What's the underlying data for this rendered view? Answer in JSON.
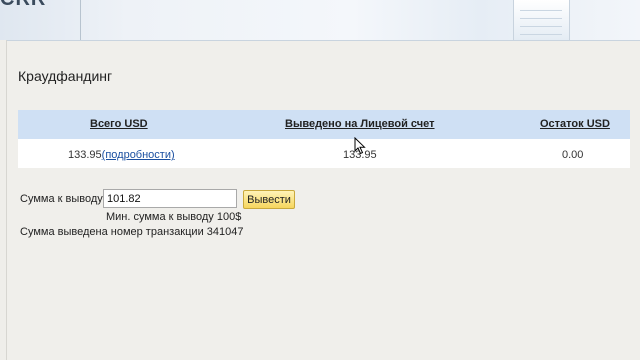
{
  "header": {
    "logo_text": "CRR"
  },
  "page": {
    "title": "Краудфандинг"
  },
  "table": {
    "columns": [
      "Всего USD",
      "Выведено на Лицевой счет",
      "Остаток USD"
    ],
    "row": {
      "total": "133.95",
      "details_link": "(подробности)",
      "withdrawn": "133.95",
      "remainder": "0.00"
    }
  },
  "form": {
    "label": "Сумма к выводу",
    "amount_value": "101.82",
    "submit_label": "Вывести",
    "min_hint": "Мин. сумма к выводу 100$",
    "status_message": "Сумма выведена номер транзакции 341047"
  },
  "colors": {
    "table_header_bg": "#cfe0f4",
    "button_bg": "#f6d65e",
    "page_bg": "#f0efeb"
  }
}
